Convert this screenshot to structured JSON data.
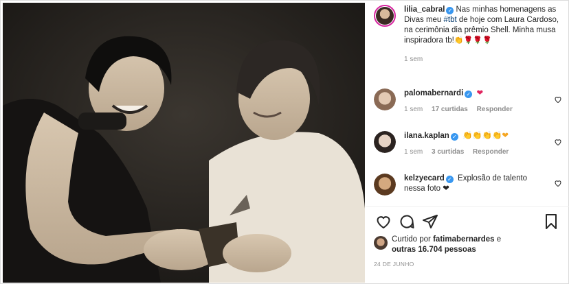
{
  "post": {
    "author": {
      "username": "lilia_cabral",
      "caption_before_tag": "Nas minhas homenagens as Divas meu ",
      "hashtag": "#tbt",
      "caption_after_tag": " de hoje com Laura Cardoso, na cerimônia dia prêmio Shell. Minha musa inspiradora tb!",
      "caption_emoji": "👏🌹🌹🌹",
      "time": "1 sem"
    },
    "comments": [
      {
        "username": "palomabernardi",
        "text": "❤",
        "time": "1 sem",
        "likes": "17 curtidas",
        "reply": "Responder"
      },
      {
        "username": "ilana.kaplan",
        "text": "👏👏👏👏❤",
        "time": "1 sem",
        "likes": "3 curtidas",
        "reply": "Responder"
      },
      {
        "username": "kelzyecard",
        "text": "Explosão de talento nessa foto ❤"
      }
    ],
    "liked_by": {
      "prefix": "Curtido por ",
      "user": "fatimabernardes",
      "middle": " e",
      "others": "outras 16.704 pessoas"
    },
    "date": "24 DE JUNHO"
  },
  "colors": {
    "verified": "#3897f0",
    "hashtag": "#00376b",
    "muted": "#8e8e8e",
    "heart": "#e0245e"
  },
  "icons": [
    "heart-icon",
    "comment-icon",
    "share-icon",
    "bookmark-icon",
    "verified-badge-icon"
  ]
}
